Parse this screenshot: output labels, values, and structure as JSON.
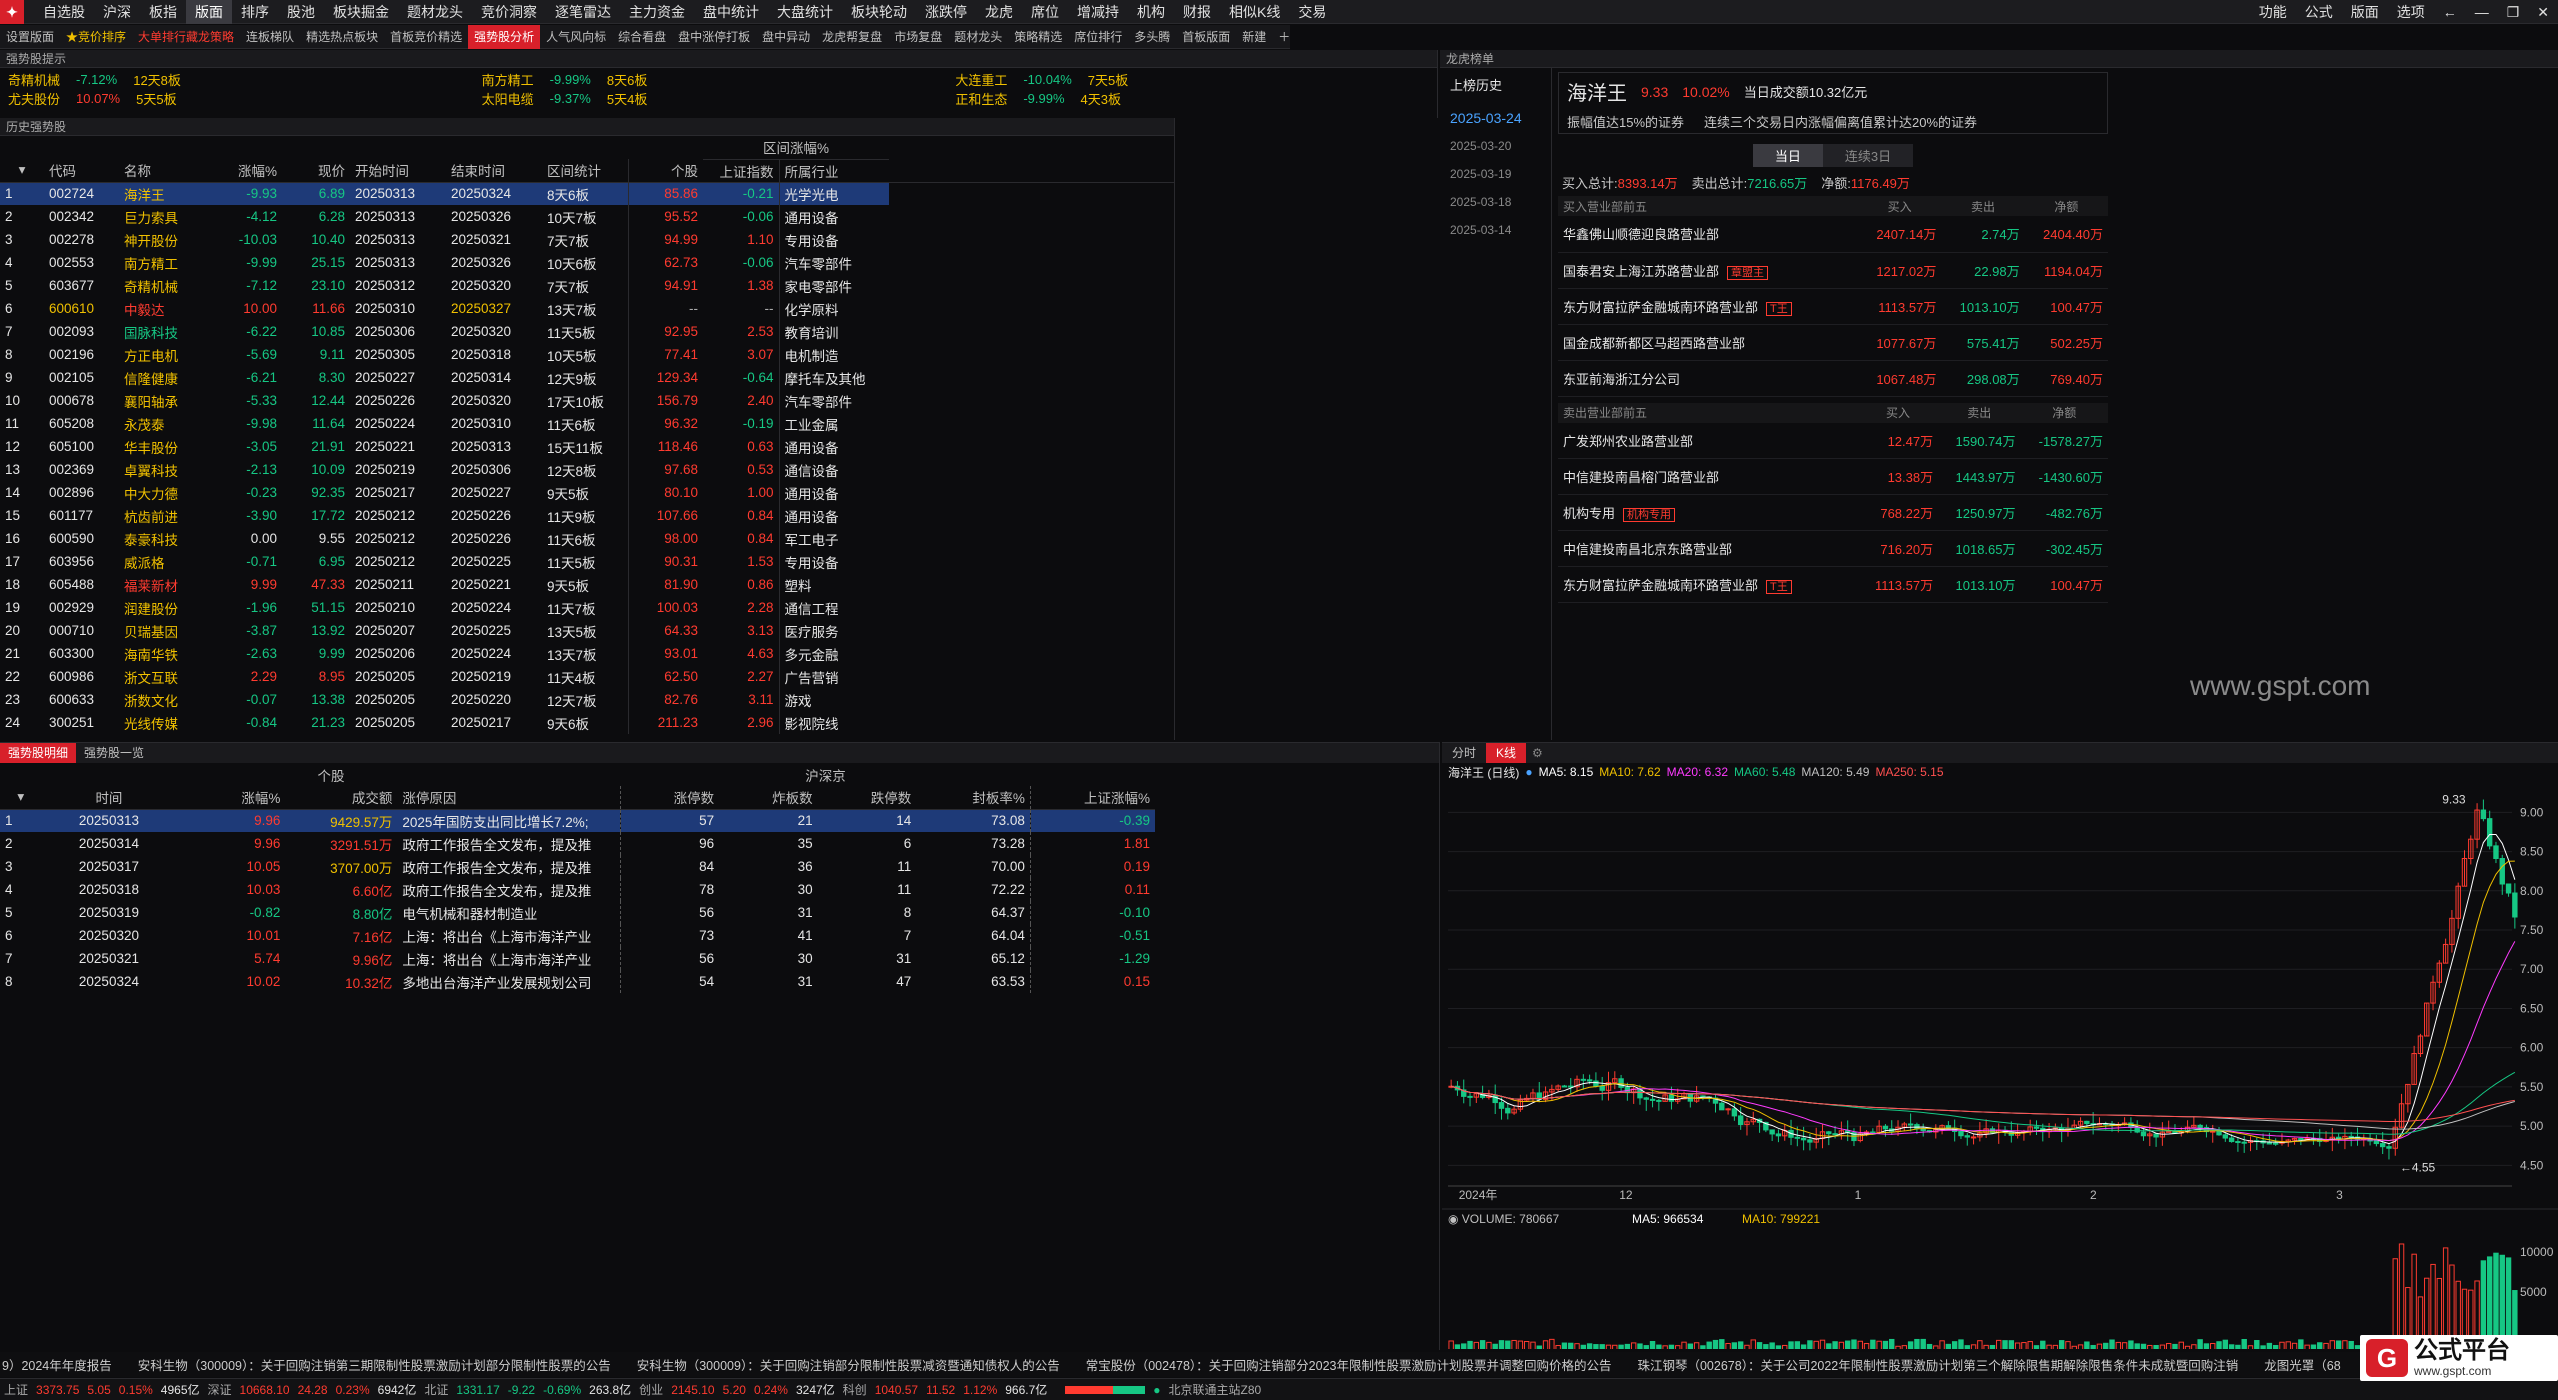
{
  "menu": {
    "items": [
      "自选股",
      "沪深",
      "板指",
      "版面",
      "排序",
      "股池",
      "板块掘金",
      "题材龙头",
      "竞价洞察",
      "逐笔雷达",
      "主力资金",
      "盘中统计",
      "大盘统计",
      "板块轮动",
      "涨跌停",
      "龙虎",
      "席位",
      "增减持",
      "机构",
      "财报",
      "相似K线",
      "交易"
    ],
    "active": "版面",
    "right": [
      "功能",
      "公式",
      "版面",
      "选项"
    ]
  },
  "subbar": {
    "items": [
      "设置版面",
      "★竞价排序",
      "大单排行藏龙策略",
      "连板梯队",
      "精选热点板块",
      "首板竞价精选",
      "强势股分析",
      "人气风向标",
      "综合看盘",
      "盘中涨停打板",
      "盘中异动",
      "龙虎帮复盘",
      "市场复盘",
      "题材龙头",
      "策略精选",
      "席位排行",
      "多头腾",
      "首板版面",
      "新建"
    ]
  },
  "tips_panel": "强势股提示",
  "ticker": [
    {
      "name": "奇精机械",
      "pct": "-7.12%",
      "note": "12天8板"
    },
    {
      "name": "南方精工",
      "pct": "-9.99%",
      "note": "8天6板"
    },
    {
      "name": "大连重工",
      "pct": "-10.04%",
      "note": "7天5板"
    },
    {
      "name": "尤夫股份",
      "pct": "10.07%",
      "note": "5天5板"
    },
    {
      "name": "太阳电缆",
      "pct": "-9.37%",
      "note": "5天4板"
    },
    {
      "name": "正和生态",
      "pct": "-9.99%",
      "note": "4天3板"
    }
  ],
  "hist": {
    "title": "历史强势股",
    "interval_header": "区间涨幅%",
    "headers": [
      "代码",
      "名称",
      "涨幅%",
      "现价",
      "开始时间",
      "结束时间",
      "区间统计",
      "个股",
      "上证指数",
      "所属行业"
    ],
    "rows": [
      [
        "1",
        "002724",
        "海洋王",
        "-9.93",
        "6.89",
        "20250313",
        "20250324",
        "8天6板",
        "85.86",
        "-0.21",
        "光学光电"
      ],
      [
        "2",
        "002342",
        "巨力索具",
        "-4.12",
        "6.28",
        "20250313",
        "20250326",
        "10天7板",
        "95.52",
        "-0.06",
        "通用设备"
      ],
      [
        "3",
        "002278",
        "神开股份",
        "-10.03",
        "10.40",
        "20250313",
        "20250321",
        "7天7板",
        "94.99",
        "1.10",
        "专用设备"
      ],
      [
        "4",
        "002553",
        "南方精工",
        "-9.99",
        "25.15",
        "20250313",
        "20250326",
        "10天6板",
        "62.73",
        "-0.06",
        "汽车零部件"
      ],
      [
        "5",
        "603677",
        "奇精机械",
        "-7.12",
        "23.10",
        "20250312",
        "20250320",
        "7天7板",
        "94.91",
        "1.38",
        "家电零部件"
      ],
      [
        "6",
        "600610",
        "中毅达",
        "10.00",
        "11.66",
        "20250310",
        "20250327",
        "13天7板",
        "--",
        "--",
        "化学原料"
      ],
      [
        "7",
        "002093",
        "国脉科技",
        "-6.22",
        "10.85",
        "20250306",
        "20250320",
        "11天5板",
        "92.95",
        "2.53",
        "教育培训"
      ],
      [
        "8",
        "002196",
        "方正电机",
        "-5.69",
        "9.11",
        "20250305",
        "20250318",
        "10天5板",
        "77.41",
        "3.07",
        "电机制造"
      ],
      [
        "9",
        "002105",
        "信隆健康",
        "-6.21",
        "8.30",
        "20250227",
        "20250314",
        "12天9板",
        "129.34",
        "-0.64",
        "摩托车及其他"
      ],
      [
        "10",
        "000678",
        "襄阳轴承",
        "-5.33",
        "12.44",
        "20250226",
        "20250320",
        "17天10板",
        "156.79",
        "2.40",
        "汽车零部件"
      ],
      [
        "11",
        "605208",
        "永茂泰",
        "-9.98",
        "11.64",
        "20250224",
        "20250310",
        "11天6板",
        "96.32",
        "-0.19",
        "工业金属"
      ],
      [
        "12",
        "605100",
        "华丰股份",
        "-3.05",
        "21.91",
        "20250221",
        "20250313",
        "15天11板",
        "118.46",
        "0.63",
        "通用设备"
      ],
      [
        "13",
        "002369",
        "卓翼科技",
        "-2.13",
        "10.09",
        "20250219",
        "20250306",
        "12天8板",
        "97.68",
        "0.53",
        "通信设备"
      ],
      [
        "14",
        "002896",
        "中大力德",
        "-0.23",
        "92.35",
        "20250217",
        "20250227",
        "9天5板",
        "80.10",
        "1.00",
        "通用设备"
      ],
      [
        "15",
        "601177",
        "杭齿前进",
        "-3.90",
        "17.72",
        "20250212",
        "20250226",
        "11天9板",
        "107.66",
        "0.84",
        "通用设备"
      ],
      [
        "16",
        "600590",
        "泰豪科技",
        "0.00",
        "9.55",
        "20250212",
        "20250226",
        "11天6板",
        "98.00",
        "0.84",
        "军工电子"
      ],
      [
        "17",
        "603956",
        "威派格",
        "-0.71",
        "6.95",
        "20250212",
        "20250225",
        "11天5板",
        "90.31",
        "1.53",
        "专用设备"
      ],
      [
        "18",
        "605488",
        "福莱新材",
        "9.99",
        "47.33",
        "20250211",
        "20250221",
        "9天5板",
        "81.90",
        "0.86",
        "塑料"
      ],
      [
        "19",
        "002929",
        "润建股份",
        "-1.96",
        "51.15",
        "20250210",
        "20250224",
        "11天7板",
        "100.03",
        "2.28",
        "通信工程"
      ],
      [
        "20",
        "000710",
        "贝瑞基因",
        "-3.87",
        "13.92",
        "20250207",
        "20250225",
        "13天5板",
        "64.33",
        "3.13",
        "医疗服务"
      ],
      [
        "21",
        "603300",
        "海南华铁",
        "-2.63",
        "9.99",
        "20250206",
        "20250224",
        "13天7板",
        "93.01",
        "4.63",
        "多元金融"
      ],
      [
        "22",
        "600986",
        "浙文互联",
        "2.29",
        "8.95",
        "20250205",
        "20250219",
        "11天4板",
        "62.50",
        "2.27",
        "广告营销"
      ],
      [
        "23",
        "600633",
        "浙数文化",
        "-0.07",
        "13.38",
        "20250205",
        "20250220",
        "12天7板",
        "82.76",
        "3.11",
        "游戏"
      ],
      [
        "24",
        "300251",
        "光线传媒",
        "-0.84",
        "21.23",
        "20250205",
        "20250217",
        "9天6板",
        "211.23",
        "2.96",
        "影视院线"
      ]
    ]
  },
  "lhb": {
    "panel": "龙虎榜单",
    "tab": "上榜历史",
    "dates": [
      "2025-03-24",
      "2025-03-20",
      "2025-03-19",
      "2025-03-18",
      "2025-03-14"
    ],
    "stock": "海洋王",
    "price": "9.33",
    "pct": "10.02%",
    "turnover": "当日成交额10.32亿元",
    "reason1": "振幅值达15%的证券",
    "reason2": "连续三个交易日内涨幅偏离值累计达20%的证券",
    "toggle": [
      "当日",
      "连续3日"
    ],
    "buy_total_label": "买入总计:",
    "buy_total": "8393.14万",
    "sell_total_label": "卖出总计:",
    "sell_total": "7216.65万",
    "net_label": "净额:",
    "net": "1176.49万",
    "buy_header": [
      "买入营业部前五",
      "买入",
      "卖出",
      "净额"
    ],
    "buy": [
      [
        "华鑫佛山顺德迎良路营业部",
        "",
        "2407.14万",
        "2.74万",
        "2404.40万"
      ],
      [
        "国泰君安上海江苏路营业部",
        "章盟主",
        "1217.02万",
        "22.98万",
        "1194.04万"
      ],
      [
        "东方财富拉萨金融城南环路营业部",
        "T王",
        "1113.57万",
        "1013.10万",
        "100.47万"
      ],
      [
        "国金成都新都区马超西路营业部",
        "",
        "1077.67万",
        "575.41万",
        "502.25万"
      ],
      [
        "东亚前海浙江分公司",
        "",
        "1067.48万",
        "298.08万",
        "769.40万"
      ]
    ],
    "sell_header": [
      "卖出营业部前五",
      "买入",
      "卖出",
      "净额"
    ],
    "sell": [
      [
        "广发郑州农业路营业部",
        "",
        "12.47万",
        "1590.74万",
        "-1578.27万"
      ],
      [
        "中信建投南昌榕门路营业部",
        "",
        "13.38万",
        "1443.97万",
        "-1430.60万"
      ],
      [
        "机构专用",
        "机构专用",
        "768.22万",
        "1250.97万",
        "-482.76万"
      ],
      [
        "中信建投南昌北京东路营业部",
        "",
        "716.20万",
        "1018.65万",
        "-302.45万"
      ],
      [
        "东方财富拉萨金融城南环路营业部",
        "T王",
        "1113.57万",
        "1013.10万",
        "100.47万"
      ]
    ]
  },
  "watermark": "www.gspt.com",
  "detail": {
    "tabs": [
      "强势股明细",
      "强势股一览"
    ],
    "group1": "个股",
    "group2": "沪深京",
    "headers": [
      "时间",
      "涨幅%",
      "成交额",
      "涨停原因",
      "涨停数",
      "炸板数",
      "跌停数",
      "封板率%",
      "上证涨幅%"
    ],
    "rows": [
      [
        "1",
        "20250313",
        "9.96",
        "9429.57万",
        "2025年国防支出同比增长7.2%;",
        "57",
        "21",
        "14",
        "73.08",
        "-0.39"
      ],
      [
        "2",
        "20250314",
        "9.96",
        "3291.51万",
        "政府工作报告全文发布，提及推",
        "96",
        "35",
        "6",
        "73.28",
        "1.81"
      ],
      [
        "3",
        "20250317",
        "10.05",
        "3707.00万",
        "政府工作报告全文发布，提及推",
        "84",
        "36",
        "11",
        "70.00",
        "0.19"
      ],
      [
        "4",
        "20250318",
        "10.03",
        "6.60亿",
        "政府工作报告全文发布，提及推",
        "78",
        "30",
        "11",
        "72.22",
        "0.11"
      ],
      [
        "5",
        "20250319",
        "-0.82",
        "8.80亿",
        "电气机械和器材制造业",
        "56",
        "31",
        "8",
        "64.37",
        "-0.10"
      ],
      [
        "6",
        "20250320",
        "10.01",
        "7.16亿",
        "上海：将出台《上海市海洋产业",
        "73",
        "41",
        "7",
        "64.04",
        "-0.51"
      ],
      [
        "7",
        "20250321",
        "5.74",
        "9.96亿",
        "上海：将出台《上海市海洋产业",
        "56",
        "30",
        "31",
        "65.12",
        "-1.29"
      ],
      [
        "8",
        "20250324",
        "10.02",
        "10.32亿",
        "多地出台海洋产业发展规划公司",
        "54",
        "31",
        "47",
        "63.53",
        "0.15"
      ]
    ]
  },
  "kchart": {
    "tabs": [
      "分时",
      "K线"
    ],
    "title": "海洋王 (日线)",
    "ma": [
      {
        "k": "MA5: 8.15",
        "c": "#ffffff"
      },
      {
        "k": "MA10: 7.62",
        "c": "#f0c000"
      },
      {
        "k": "MA20: 6.32",
        "c": "#ff3bff"
      },
      {
        "k": "MA60: 5.48",
        "c": "#16c784"
      },
      {
        "k": "MA120: 5.49",
        "c": "#c0c0c0"
      },
      {
        "k": "MA250: 5.15",
        "c": "#ff5050"
      }
    ],
    "yticks": [
      "9.00",
      "8.50",
      "8.00",
      "7.50",
      "7.00",
      "6.50",
      "6.00",
      "5.50",
      "5.00",
      "4.50"
    ],
    "xticks": [
      "2024年",
      "12",
      "1",
      "2",
      "3"
    ],
    "high": "9.33",
    "low": "4.55",
    "vol_label": "VOLUME: 780667",
    "vol_ma5": "MA5: 966534",
    "vol_ma10": "MA10: 799221",
    "vol_ticks": [
      "10000",
      "5000",
      "X100"
    ]
  },
  "news": [
    "9）2024年年度报告",
    "安科生物（300009）：关于回购注销第三期限制性股票激励计划部分限制性股票的公告",
    "安科生物（300009）：关于回购注销部分限制性股票减资暨通知债权人的公告",
    "常宝股份（002478）：关于回购注销部分2023年限制性股票激励计划股票并调整回购价格的公告",
    "珠江钢琴（002678）：关于公司2022年限制性股票激励计划第三个解除限售期解除限售条件未成就暨回购注销",
    "龙图光罩（68"
  ],
  "status": [
    {
      "l": "上证",
      "v": "3373.75",
      "c": "5.05",
      "p": "0.15%",
      "a": "4965亿"
    },
    {
      "l": "深证",
      "v": "10668.10",
      "c": "24.28",
      "p": "0.23%",
      "a": "6942亿"
    },
    {
      "l": "北证",
      "v": "1331.17",
      "c": "-9.22",
      "p": "-0.69%",
      "a": "263.8亿"
    },
    {
      "l": "创业",
      "v": "2145.10",
      "c": "5.20",
      "p": "0.24%",
      "a": "3247亿"
    },
    {
      "l": "科创",
      "v": "1040.57",
      "c": "11.52",
      "p": "1.12%",
      "a": "966.7亿"
    }
  ],
  "status_right": "北京联通主站Z80",
  "brand": {
    "name": "公式平台",
    "url": "www.gspt.com"
  }
}
